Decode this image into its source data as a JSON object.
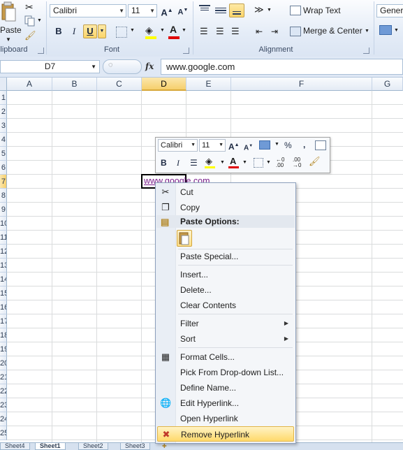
{
  "ribbon": {
    "clipboard": {
      "paste_label": "Paste",
      "group_label": "Clipboard"
    },
    "font": {
      "font_name": "Calibri",
      "font_size": "11",
      "group_label": "Font",
      "bold": "B",
      "italic": "I",
      "underline": "U"
    },
    "alignment": {
      "wrap_text": "Wrap Text",
      "merge_center": "Merge & Center",
      "group_label": "Alignment"
    },
    "number": {
      "format": "General"
    }
  },
  "formula_bar": {
    "name_box": "D7",
    "fx": "fx",
    "content": "www.google.com"
  },
  "grid": {
    "columns": [
      "A",
      "B",
      "C",
      "D",
      "E",
      "F",
      "G"
    ],
    "selected_column": "D",
    "rows": [
      "1",
      "2",
      "3",
      "4",
      "5",
      "6",
      "7",
      "8",
      "9",
      "10",
      "11",
      "12",
      "13",
      "14",
      "15",
      "16",
      "17",
      "18",
      "19",
      "20",
      "21",
      "22",
      "23",
      "24",
      "25"
    ],
    "selected_row": "7",
    "active_cell_value": "www.google.com"
  },
  "sheet_tabs": [
    "Sheet4",
    "Sheet1",
    "Sheet2",
    "Sheet3"
  ],
  "mini_toolbar": {
    "font_name": "Calibri",
    "font_size": "11",
    "percent": "%",
    "comma": ",",
    "bold": "B",
    "italic": "I"
  },
  "context_menu": {
    "items": [
      {
        "label": "Cut",
        "icon": "scissors-icon"
      },
      {
        "label": "Copy",
        "icon": "copy-icon"
      },
      {
        "label": "Paste Options:",
        "header": true
      },
      {
        "label": "Paste Special...",
        "icon": ""
      },
      {
        "label": "Insert...",
        "icon": ""
      },
      {
        "label": "Delete...",
        "icon": ""
      },
      {
        "label": "Clear Contents",
        "icon": ""
      },
      {
        "label": "Filter",
        "submenu": true
      },
      {
        "label": "Sort",
        "submenu": true
      },
      {
        "label": "Format Cells...",
        "icon": "format-cells-icon"
      },
      {
        "label": "Pick From Drop-down List...",
        "icon": ""
      },
      {
        "label": "Define Name...",
        "icon": ""
      },
      {
        "label": "Edit Hyperlink...",
        "icon": "hyperlink-icon"
      },
      {
        "label": "Open Hyperlink",
        "icon": ""
      },
      {
        "label": "Remove Hyperlink",
        "icon": "remove-hyperlink-icon",
        "highlighted": true
      }
    ]
  },
  "colors": {
    "hyperlink": "#7a1f8c",
    "selection_header": "#f6cf6c",
    "menu_highlight": "#ffd96b"
  }
}
